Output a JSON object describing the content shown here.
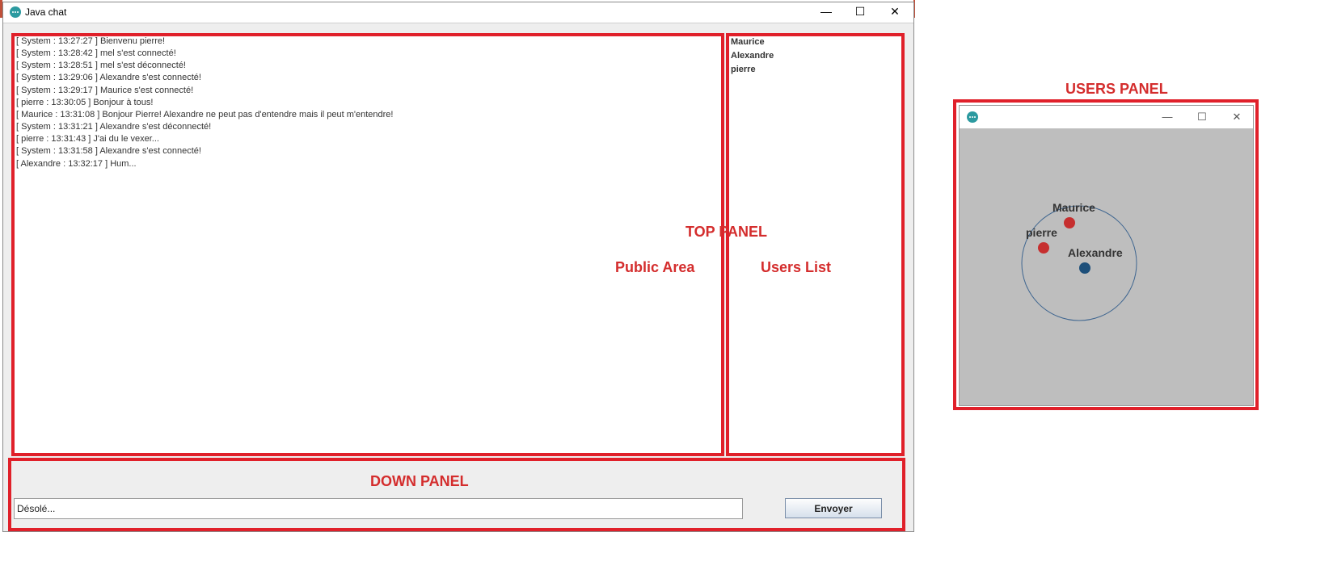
{
  "window": {
    "title": "Java chat",
    "minimize_glyph": "—",
    "maximize_glyph": "☐",
    "close_glyph": "✕"
  },
  "chat": {
    "messages": [
      "[ System : 13:27:27 ] Bienvenu pierre!",
      "[ System : 13:28:42 ] mel s'est connecté!",
      "[ System : 13:28:51 ] mel s'est déconnecté!",
      "[ System : 13:29:06 ] Alexandre s'est connecté!",
      "[ System : 13:29:17 ] Maurice s'est connecté!",
      "[ pierre : 13:30:05 ] Bonjour à tous!",
      "[ Maurice : 13:31:08 ] Bonjour Pierre! Alexandre ne peut pas d'entendre mais il peut m'entendre!",
      "[ System : 13:31:21 ] Alexandre s'est déconnecté!",
      "[ pierre : 13:31:43 ] J'ai du le vexer...",
      "[ System : 13:31:58 ] Alexandre s'est connecté!",
      "[ Alexandre : 13:32:17 ] Hum..."
    ]
  },
  "users_list": [
    "Maurice",
    "Alexandre",
    "pierre"
  ],
  "input": {
    "value": "Désolé..."
  },
  "send_button": {
    "label": "Envoyer"
  },
  "annotations": {
    "top_panel": "TOP PANEL",
    "public_area": "Public Area",
    "users_list": "Users List",
    "down_panel": "DOWN PANEL",
    "users_panel": "USERS PANEL"
  },
  "users_panel": {
    "window": {
      "minimize_glyph": "—",
      "maximize_glyph": "☐",
      "close_glyph": "✕"
    },
    "users": [
      {
        "name": "Maurice",
        "color": "#c62f2f"
      },
      {
        "name": "pierre",
        "color": "#c62f2f"
      },
      {
        "name": "Alexandre",
        "color": "#1d4f7a"
      }
    ],
    "range_circle_color": "#3f6690"
  },
  "colors": {
    "annotation": "#d42d2d",
    "annotation_box": "#e0202a",
    "canvas_bg": "#bebebe"
  }
}
